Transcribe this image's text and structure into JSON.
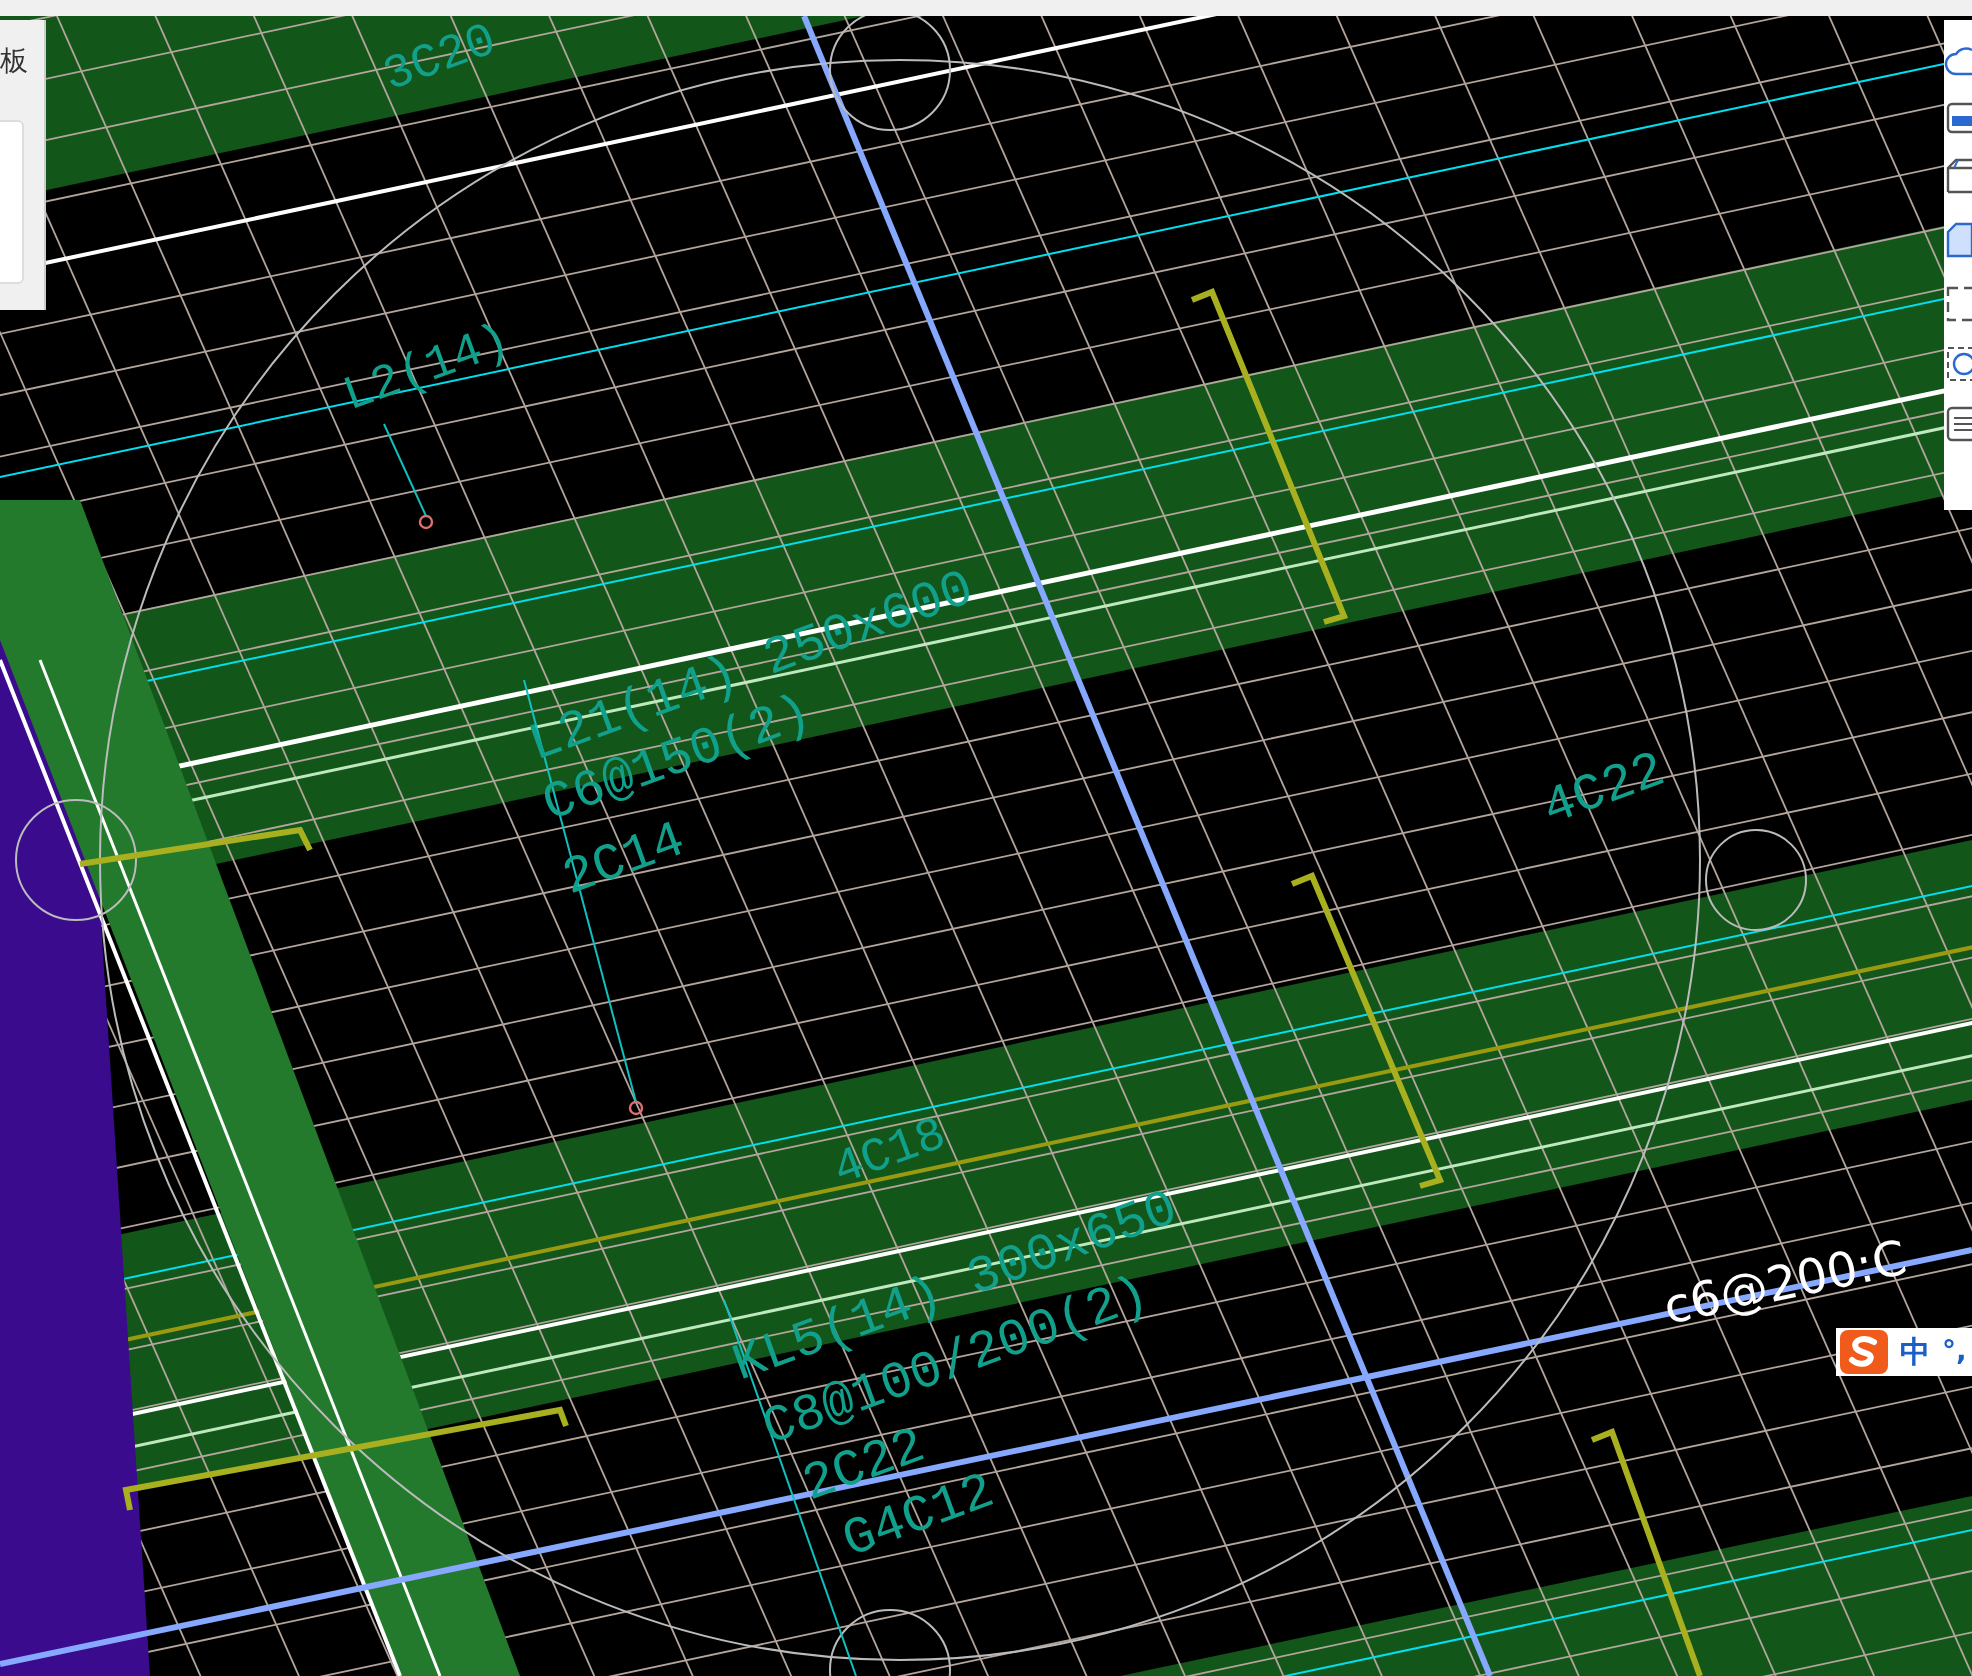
{
  "left_panel": {
    "title": "板"
  },
  "drawing": {
    "labels": [
      {
        "text": "3C20"
      },
      {
        "text": "L2(14)"
      },
      {
        "text": "L21(14) 250x600"
      },
      {
        "text": "C6@150(2)"
      },
      {
        "text": "2C14"
      },
      {
        "text": "4C22"
      },
      {
        "text": "4C18"
      },
      {
        "text": "KL5(14) 300x650"
      },
      {
        "text": "C8@100/200(2)"
      },
      {
        "text": "2C22"
      },
      {
        "text": "G4C12"
      }
    ]
  },
  "cursor_input": {
    "text": "c6@200:C"
  },
  "ime_bar": {
    "mode": "中",
    "punctuation": "°,"
  }
}
